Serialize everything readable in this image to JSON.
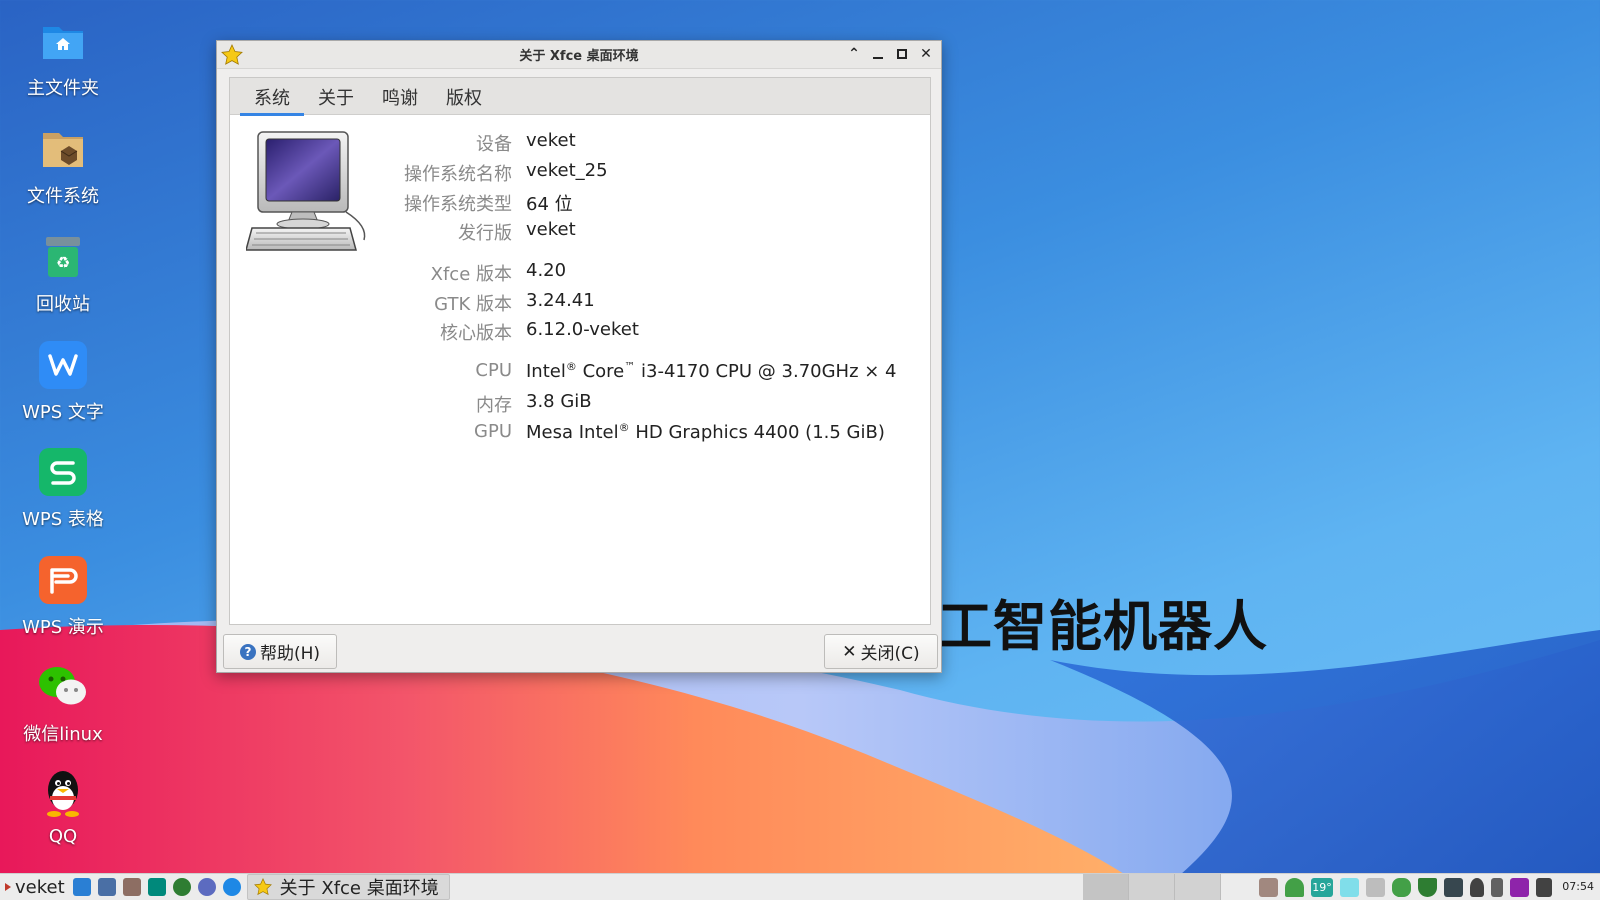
{
  "wallpaper": {
    "text": "工智能机器人"
  },
  "desktop": {
    "icons": [
      {
        "label": "主文件夹",
        "icon": "home-folder-icon"
      },
      {
        "label": "文件系统",
        "icon": "filesystem-folder-icon"
      },
      {
        "label": "回收站",
        "icon": "trash-icon"
      },
      {
        "label": "WPS 文字",
        "icon": "wps-writer-icon"
      },
      {
        "label": "WPS 表格",
        "icon": "wps-spreadsheet-icon"
      },
      {
        "label": "WPS 演示",
        "icon": "wps-presentation-icon"
      },
      {
        "label": "微信linux",
        "icon": "wechat-icon"
      },
      {
        "label": "QQ",
        "icon": "qq-penguin-icon"
      }
    ]
  },
  "window": {
    "title": "关于 Xfce 桌面环境",
    "tabs": [
      {
        "label": "系统",
        "active": true
      },
      {
        "label": "关于"
      },
      {
        "label": "鸣谢"
      },
      {
        "label": "版权"
      }
    ],
    "info": {
      "device": {
        "key": "设备",
        "value": "veket"
      },
      "os_name": {
        "key": "操作系统名称",
        "value": "veket_25"
      },
      "os_type": {
        "key": "操作系统类型",
        "value": "64 位"
      },
      "distro": {
        "key": "发行版",
        "value": "veket"
      },
      "xfce": {
        "key": "Xfce 版本",
        "value": "4.20"
      },
      "gtk": {
        "key": "GTK 版本",
        "value": "3.24.41"
      },
      "kernel": {
        "key": "核心版本",
        "value": "6.12.0-veket"
      },
      "cpu": {
        "key": "CPU",
        "v1": "Intel",
        "v2": "Core",
        "v3": "i3-4170 CPU @ 3.70GHz × 4",
        "reg": "®",
        "tm": "™"
      },
      "memory": {
        "key": "内存",
        "value": "3.8 GiB"
      },
      "gpu": {
        "key": "GPU",
        "v1": "Mesa Intel",
        "v2": "HD Graphics 4400 (1.5 GiB)",
        "reg": "®"
      }
    },
    "help_button": "帮助(H)",
    "close_button": "关闭(C)",
    "close_glyph": "✕"
  },
  "taskbar": {
    "menu_label": "veket",
    "task_title": "关于 Xfce 桌面环境",
    "tray_temp": "19°",
    "clock": "07:54"
  },
  "colors": {
    "accent": "#3584e4"
  }
}
